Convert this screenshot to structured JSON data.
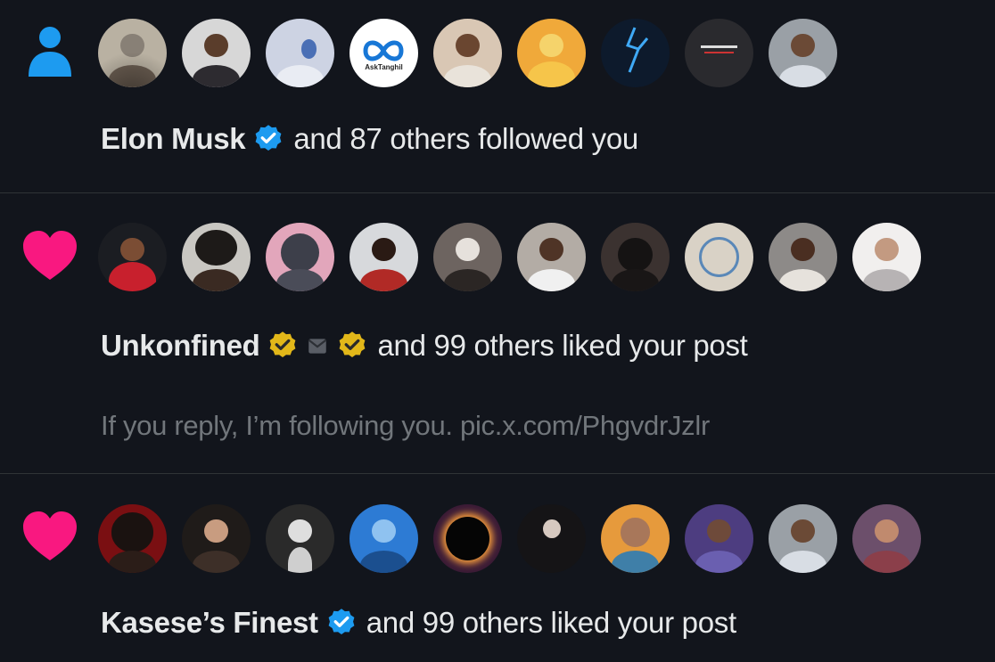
{
  "colors": {
    "background": "#12151c",
    "divider": "#2f3336",
    "follow_icon": "#1d9bf0",
    "like_icon": "#f91880",
    "blue_check": "#1d9bf0",
    "gold_check": "#e2b719",
    "primary_text": "#e7e9ea",
    "secondary_text": "#71767b"
  },
  "notifications": [
    {
      "type": "follow",
      "icon": "person-icon",
      "name": "Elon Musk",
      "badge": "blue-verified-badge",
      "rest": "and 87 others followed you",
      "avatar_count": 9
    },
    {
      "type": "like",
      "icon": "heart-icon",
      "name": "Unkonfined",
      "badge": "gold-verified-badge",
      "extra_icons": [
        "organization-affiliate-icon",
        "gold-verified-badge"
      ],
      "rest": "and 99 others liked your post",
      "snippet": "If you reply, I’m following you. pic.x.com/PhgvdrJzlr",
      "avatar_count": 10
    },
    {
      "type": "like",
      "icon": "heart-icon",
      "name": "Kasese’s Finest",
      "badge": "blue-verified-badge",
      "rest": "and 99 others liked your post",
      "avatar_count": 10
    }
  ],
  "avatar_texts": {
    "infinity_logo_caption": "AskTanghil"
  }
}
